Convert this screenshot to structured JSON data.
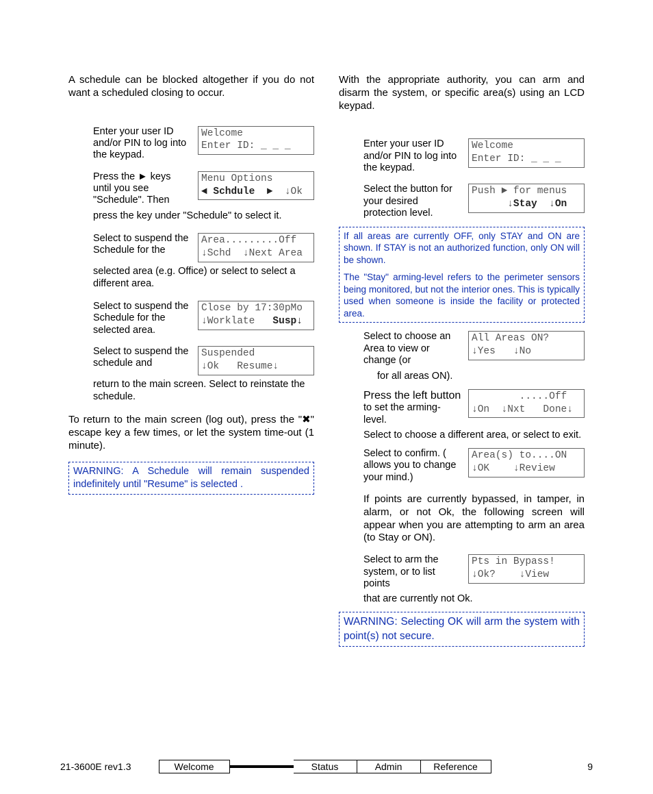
{
  "left": {
    "intro": "A schedule can be blocked altogether if you do not want a scheduled closing to occur.",
    "s1_txt": "Enter your user ID and/or PIN to log into the keypad.",
    "s1_lcd_l1": "Welcome",
    "s1_lcd_l2": "Enter ID: _ _ _",
    "s2_txt": "Press the ► keys until you see \"Schedule\".  Then",
    "s2_lcd_l1": "Menu Options",
    "s2_lcd_l2a": "◄ Schdule  ►",
    "s2_lcd_l2b": "  ↓Ok",
    "s2_cont": "press the key under \"Schedule\" to select it.",
    "s3_txt": "Select         to suspend the Schedule for the",
    "s3_lcd_l1": "Area.........Off",
    "s3_lcd_l2": "↓Schd  ↓Next Area",
    "s3_cont": "selected area (e.g. Office) or select          to select a different area.",
    "s4_txt": "Select         to suspend the Schedule for the selected area.",
    "s4_lcd_l1": "Close by 17:30pMo",
    "s4_lcd_l2a": "↓Worklate   ",
    "s4_lcd_l2b": "Susp↓",
    "s5_txt": "Select         to suspend the schedule and",
    "s5_lcd_l1": "Suspended",
    "s5_lcd_l2": "↓Ok   Resume↓",
    "s5_cont": "return to the main screen. Select            to reinstate the schedule.",
    "return_para": "To return to the main screen (log out), press the \"✖\" escape key a few times, or let the system time-out (1 minute).",
    "warn": "WARNING: A Schedule will remain suspended indefinitely until \"Resume\" is selected ."
  },
  "right": {
    "intro": "With the appropriate authority, you can arm and disarm the system, or specific area(s) using an LCD keypad.",
    "s1_txt": "Enter your user ID and/or PIN to log into the keypad.",
    "s1_lcd_l1": "Welcome",
    "s1_lcd_l2": "Enter ID: _ _ _",
    "s2_txt": "Select the button for your desired protection level.",
    "s2_lcd_l1": "Push ► for menus",
    "s2_lcd_l2a": "      ↓",
    "s2_lcd_l2b": "Stay",
    "s2_lcd_l2c": "  ↓",
    "s2_lcd_l2d": "On",
    "note1": "If all areas are currently OFF, only STAY and ON are shown. If STAY is not an authorized function, only ON will be shown.",
    "note2": "The \"Stay\" arming-level refers to the perimeter sensors being monitored, but not the interior ones. This is typically used when someone is inside the facility or protected area.",
    "s3_txt": "Select        to choose an Area to view or change (or",
    "s3_lcd_l1": "All Areas ON?",
    "s3_lcd_l2": "↓Yes   ↓No",
    "s3_cont": "       for all areas ON).",
    "s4_txt_a": "Press the left button",
    "s4_txt_b": " to set the arming-level.",
    "s4_lcd_l1": "        .....Off",
    "s4_lcd_l2": "↓On  ↓Nxt   Done↓",
    "s4_cont": "Select        to choose a different area, or select         to exit.",
    "s5_txt": "Select        to confirm. (          allows you to change your mind.)",
    "s5_lcd_l1": "Area(s) to....ON",
    "s5_lcd_l2": "↓OK    ↓Review",
    "midpara": "If points are currently bypassed, in tamper, in alarm, or not Ok, the following screen will appear when you are attempting to arm an area (to Stay or ON).",
    "s6_txt": "Select         to arm the system, or           to list points",
    "s6_lcd_l1": "Pts in Bypass!",
    "s6_lcd_l2": "↓Ok?    ↓View",
    "s6_cont": "that are currently not Ok.",
    "warn": "WARNING: Selecting OK will arm the system with point(s) not secure."
  },
  "footer": {
    "rev": "21-3600E rev1.3",
    "tab1": "Welcome",
    "tab2": " ",
    "tab3": "Status",
    "tab4": "Admin",
    "tab5": "Reference",
    "page": "9"
  }
}
